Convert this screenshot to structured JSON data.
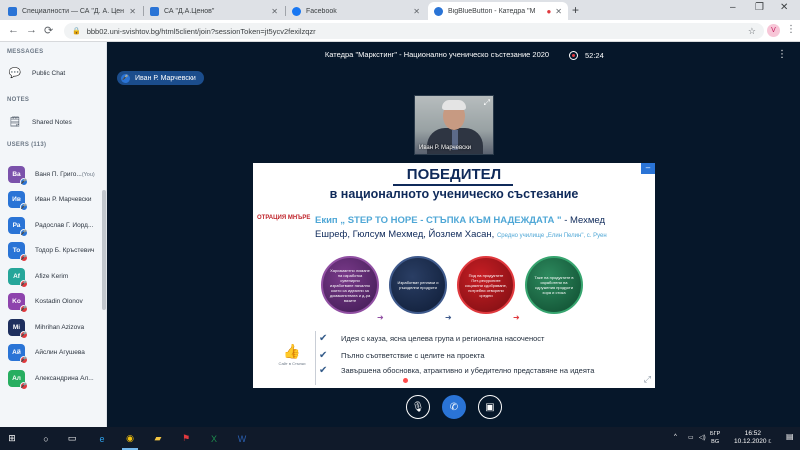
{
  "browser": {
    "tabs": [
      {
        "label": "Специалности — СА \"Д. А. Цен",
        "favicon_color": "#2a74d6"
      },
      {
        "label": "СА \"Д.А.Ценов\"",
        "favicon_color": "#2a74d6"
      },
      {
        "label": "Facebook",
        "favicon_color": "#1877f2"
      },
      {
        "label": "BigBlueButton - Катедра \"М",
        "favicon_color": "#2a74d6"
      }
    ],
    "url": "bbb02.uni-svishtov.bg/html5client/join?sessionToken=jt5ycv2fexilzqzr",
    "profile_initial": "V"
  },
  "sidebar": {
    "messages_title": "MESSAGES",
    "public_chat": "Public Chat",
    "notes_title": "NOTES",
    "shared_notes": "Shared Notes",
    "users_title": "USERS (113)",
    "users": [
      {
        "initials": "Ва",
        "name": "Ваня П. Григо...",
        "you": "(You)",
        "color": "#7b52ab",
        "mic": "#2a74d6"
      },
      {
        "initials": "Ив",
        "name": "Иван Р. Марчевски",
        "you": "",
        "color": "#2a74d6",
        "mic": "#2a74d6"
      },
      {
        "initials": "Ра",
        "name": "Радослав Г. Йорд...",
        "you": "",
        "color": "#2a74d6",
        "mic": "#2a74d6"
      },
      {
        "initials": "То",
        "name": "Тодор Б. Кръстевич",
        "you": "",
        "color": "#2a74d6",
        "mic": "#e0393e"
      },
      {
        "initials": "Af",
        "name": "Afize Kerim",
        "you": "",
        "color": "#26a69a",
        "mic": "#e0393e"
      },
      {
        "initials": "Ko",
        "name": "Kostadin Olonov",
        "you": "",
        "color": "#8e44ad",
        "mic": "#e0393e"
      },
      {
        "initials": "Mi",
        "name": "Mihrihan Azizova",
        "you": "",
        "color": "#1e2f5e",
        "mic": "#e0393e"
      },
      {
        "initials": "Ай",
        "name": "Айслин Агушева",
        "you": "",
        "color": "#2a74d6",
        "mic": "#e0393e"
      },
      {
        "initials": "Ал",
        "name": "Александрина Ал...",
        "you": "",
        "color": "#27ae60",
        "mic": "#e0393e"
      }
    ]
  },
  "meeting": {
    "title": "Катедра \"Маркстинг\" - Национално ученическо състезание 2020",
    "recording_time": "52:24",
    "talking_user": "Иван Р. Марчевски",
    "webcam_name": "Иван Р. Марчевски"
  },
  "slide": {
    "heading1": "ПОБЕДИТЕЛ",
    "heading2": "в националното ученическо състезание",
    "logo_text": "ОТРАЦИЯ МНЪРЕ",
    "team_prefix": "Екип „ STEP TO HOPE - СТЪПКА КЪМ НАДЕЖДАТА \"",
    "team_members_a": " - Мехмед",
    "team_members_b": "Ешреф, Гюлсум Мехмед, Йозлем Хасан, ",
    "school": "Средно училище „Елин Пелин\", с. Руен",
    "circles": [
      "Харизмантно лимане на изработка сувенирни изработване начално които са идеални за домакинствата и д-ра вазите",
      "Изработват реплики и ръкоделни продукти",
      "Под на продуктите Пет-ресурсните социални сдобряване, потребни отворени средни",
      "Таке на продуктите в изработени на сдружения продукти хора и стока"
    ],
    "bullets": [
      "Идея с кауза, ясна целева група и регионална насоченост",
      "Пълно съответствие с целите на проекта",
      "Завършена обосновка, атрактивно и убедително представяне на идеята"
    ],
    "like_label": "Сайт в Стъпки"
  },
  "taskbar": {
    "time": "16:52",
    "date": "10.12.2020 г.",
    "lang_top": "БГР",
    "lang_bottom": "BG"
  }
}
